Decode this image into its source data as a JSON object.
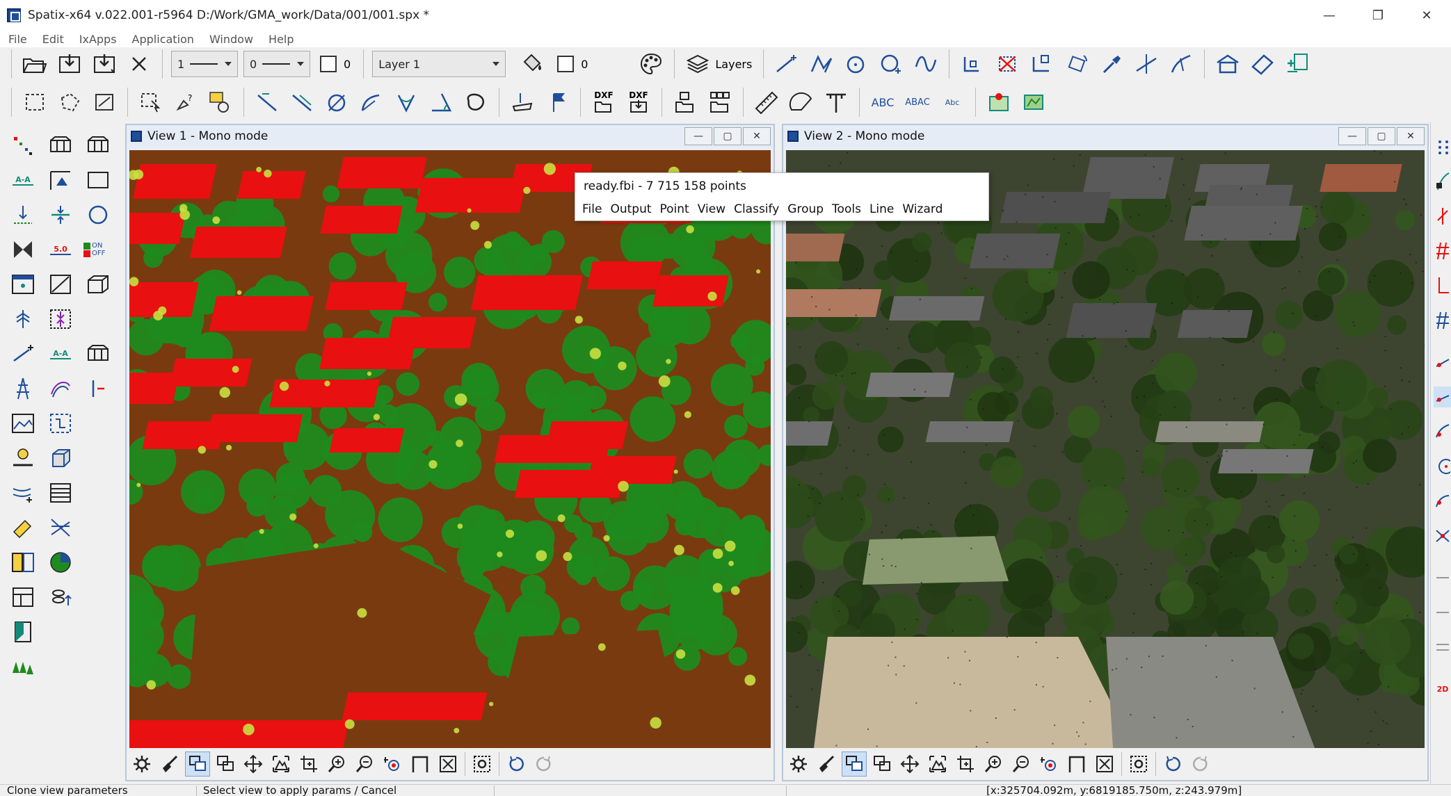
{
  "window": {
    "title": "Spatix-x64 v.022.001-r5964  D:/Work/GMA_work/Data/001/001.spx *",
    "minimize_glyph": "—",
    "restore_glyph": "❐",
    "close_glyph": "✕"
  },
  "menu": {
    "items": [
      "File",
      "Edit",
      "IxApps",
      "Application",
      "Window",
      "Help"
    ]
  },
  "toolbar1": {
    "line_width_value": "1",
    "line_style_value": "0",
    "checkbox1_value": "0",
    "layer_select_value": "Layer 1",
    "checkbox2_value": "0",
    "layers_label": "Layers"
  },
  "toolbar2": {
    "dxf_label": "DXF",
    "abc_label": "ABC",
    "abac_label": "ABAC",
    "abc_small_label": "Abc"
  },
  "left_panel": {
    "aa_label": "A-A",
    "scale_label": "5.0",
    "on_label": "ON",
    "off_label": "OFF"
  },
  "right_strip": {
    "label_2d": "2D"
  },
  "view1": {
    "title": "View 1 - Mono mode"
  },
  "view2": {
    "title": "View 2 - Mono mode"
  },
  "popup": {
    "title": "ready.fbi - 7 715 158 points",
    "menu": [
      "File",
      "Output",
      "Point",
      "View",
      "Classify",
      "Group",
      "Tools",
      "Line",
      "Wizard"
    ]
  },
  "status": {
    "left": "Clone view parameters",
    "middle": "Select view to apply params / Cancel",
    "coords": "[x:325704.092m, y:6819185.750m, z:243.979m]"
  },
  "colors": {
    "class_ground": "#7a3a10",
    "class_vegetation": "#1f8a1f",
    "class_building": "#e81010",
    "class_low_veg": "#c8e040",
    "accent_blue": "#1f4e9a",
    "icon_green": "#138a7a"
  }
}
